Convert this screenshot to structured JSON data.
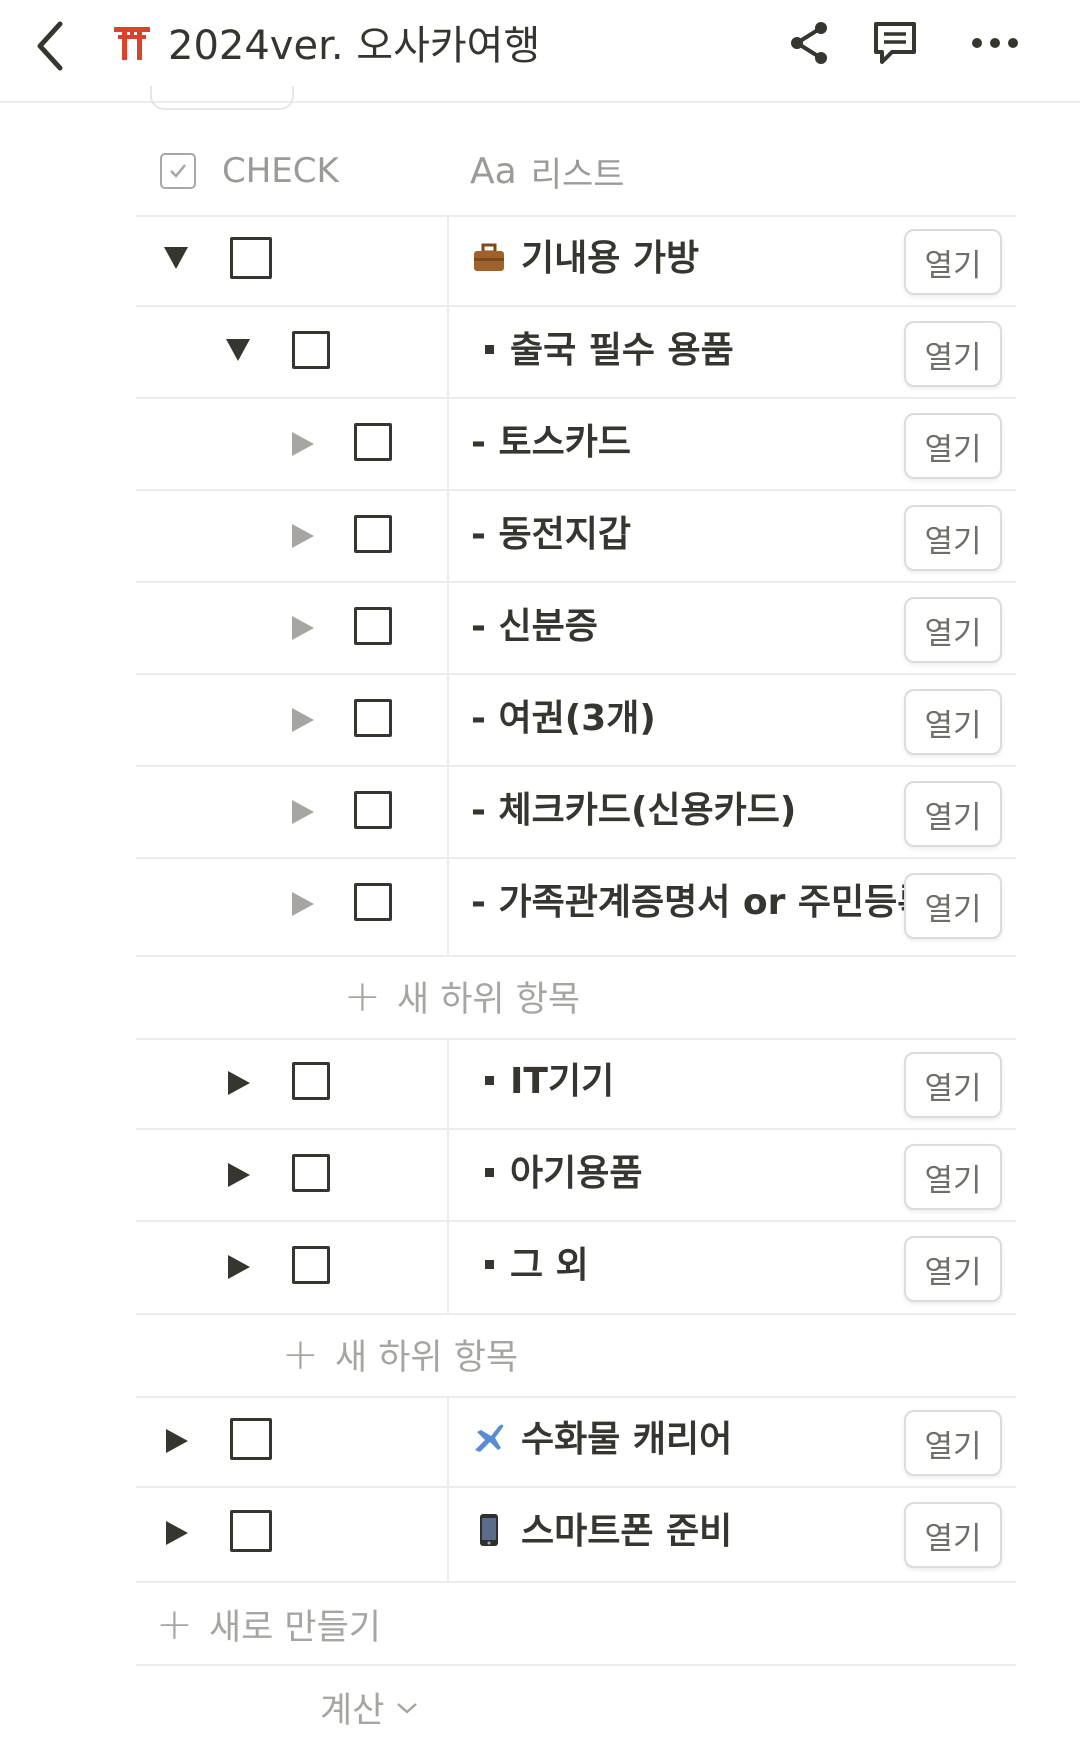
{
  "header": {
    "title": "2024ver. 오사카여행",
    "icons": [
      "back-chevron-icon",
      "torii-gate-icon",
      "share-icon",
      "comment-icon",
      "more-icon"
    ]
  },
  "columns": {
    "check": "CHECK",
    "list_prefix": "Aa",
    "list": "리스트"
  },
  "rows": [
    {
      "level": 0,
      "expanded": true,
      "icon": "briefcase-icon",
      "label": "기내용 가방",
      "open": "열기"
    },
    {
      "level": 1,
      "expanded": true,
      "icon": "bullet",
      "label": "출국 필수 용품",
      "open": "열기"
    },
    {
      "level": 2,
      "expanded": false,
      "icon": "",
      "label": "- 토스카드",
      "open": "열기"
    },
    {
      "level": 2,
      "expanded": false,
      "icon": "",
      "label": "- 동전지갑",
      "open": "열기"
    },
    {
      "level": 2,
      "expanded": false,
      "icon": "",
      "label": "- 신분증",
      "open": "열기"
    },
    {
      "level": 2,
      "expanded": false,
      "icon": "",
      "label": "- 여권(3개)",
      "open": "열기"
    },
    {
      "level": 2,
      "expanded": false,
      "icon": "",
      "label": "- 체크카드(신용카드)",
      "open": "열기"
    },
    {
      "level": 2,
      "expanded": false,
      "icon": "",
      "label": "- 가족관계증명서 or 주민등록등본",
      "open": "열기"
    },
    {
      "level": 1,
      "expanded": false,
      "icon": "bullet",
      "label": "IT기기",
      "open": "열기"
    },
    {
      "level": 1,
      "expanded": false,
      "icon": "bullet",
      "label": "아기용품",
      "open": "열기"
    },
    {
      "level": 1,
      "expanded": false,
      "icon": "bullet",
      "label": "그 외",
      "open": "열기"
    },
    {
      "level": 0,
      "expanded": false,
      "icon": "airplane-icon",
      "label": "수화물 캐리어",
      "open": "열기"
    },
    {
      "level": 0,
      "expanded": false,
      "icon": "mobile-phone-icon",
      "label": "스마트폰 준비",
      "open": "열기"
    }
  ],
  "add_sub_item": "새 하위 항목",
  "add_new": "새로 만들기",
  "calculate": "계산"
}
